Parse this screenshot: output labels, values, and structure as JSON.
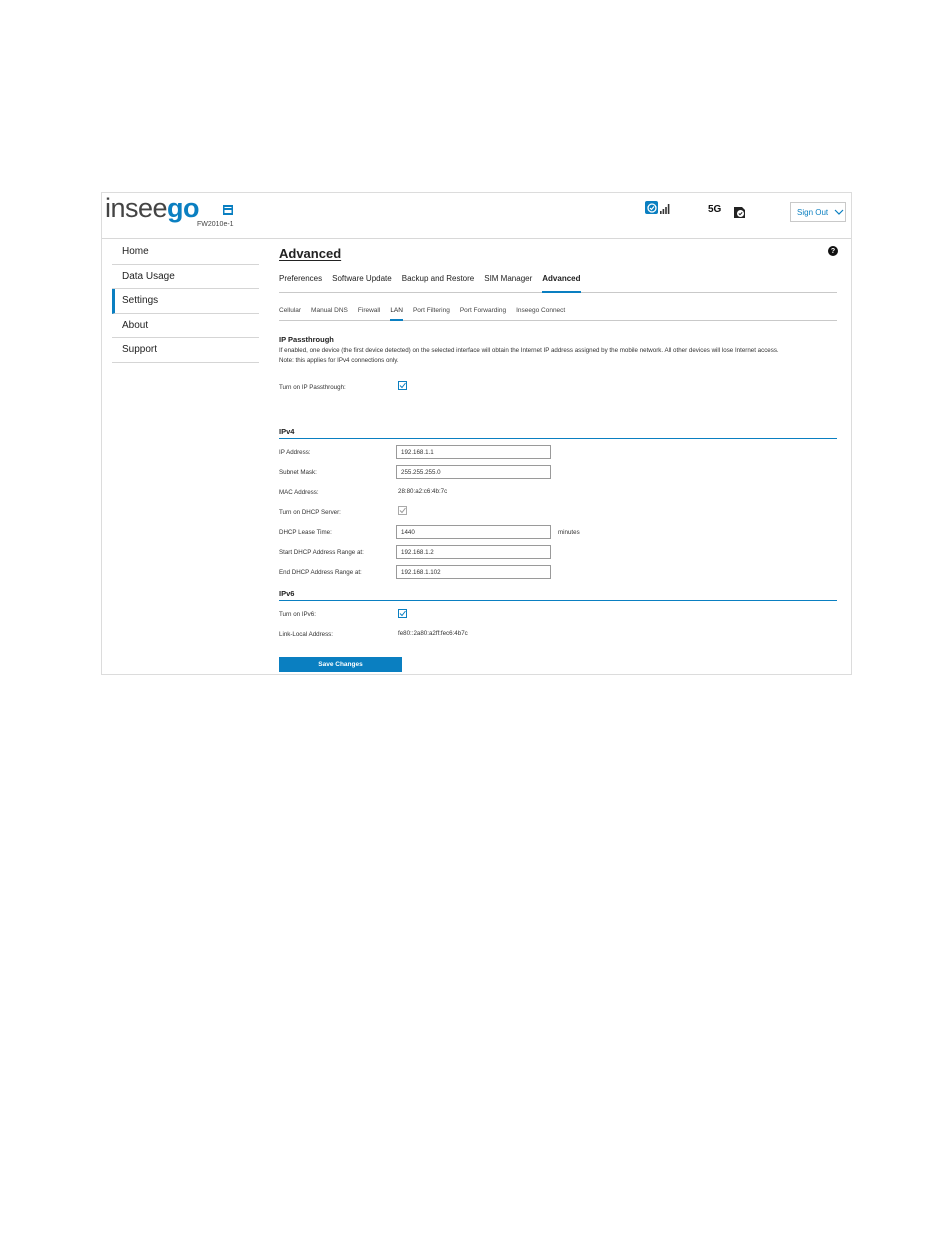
{
  "header": {
    "logo_prefix": "insee",
    "logo_suffix": "go",
    "model": "FW2010e-1",
    "network_label": "5G",
    "signout_label": "Sign Out",
    "icons": [
      "device-icon",
      "wifi-status-icon",
      "signal-bars-icon",
      "sim-icon",
      "chevron-down-icon"
    ]
  },
  "sidebar": {
    "items": [
      {
        "label": "Home"
      },
      {
        "label": "Data Usage"
      },
      {
        "label": "Settings",
        "active": true
      },
      {
        "label": "About"
      },
      {
        "label": "Support"
      }
    ]
  },
  "main": {
    "title": "Advanced",
    "help": "?",
    "tabs": [
      {
        "label": "Preferences"
      },
      {
        "label": "Software Update"
      },
      {
        "label": "Backup and Restore"
      },
      {
        "label": "SIM Manager"
      },
      {
        "label": "Advanced",
        "active": true
      }
    ],
    "subtabs": [
      {
        "label": "Cellular"
      },
      {
        "label": "Manual DNS"
      },
      {
        "label": "Firewall"
      },
      {
        "label": "LAN",
        "active": true
      },
      {
        "label": "Port Filtering"
      },
      {
        "label": "Port Forwarding"
      },
      {
        "label": "Inseego Connect"
      }
    ],
    "ip_passthrough": {
      "title": "IP Passthrough",
      "description_1": "If enabled, one device (the first device detected) on the selected interface will obtain the Internet IP address assigned by the mobile network. All other devices will lose Internet access.",
      "description_2": "Note: this applies for IPv4 connections only.",
      "toggle_label": "Turn on IP Passthrough:",
      "checked": true
    },
    "ipv4": {
      "title": "IPv4",
      "ip_label": "IP Address:",
      "ip_value": "192.168.1.1",
      "subnet_label": "Subnet Mask:",
      "subnet_value": "255.255.255.0",
      "mac_label": "MAC Address:",
      "mac_value": "28:80:a2:c6:4b:7c",
      "dhcp_label": "Turn on DHCP Server:",
      "dhcp_checked": true,
      "lease_label": "DHCP Lease Time:",
      "lease_value": "1440",
      "lease_unit": "minutes",
      "start_label": "Start DHCP Address Range at:",
      "start_value": "192.168.1.2",
      "end_label": "End DHCP Address Range at:",
      "end_value": "192.168.1.102"
    },
    "ipv6": {
      "title": "IPv6",
      "toggle_label": "Turn on IPv6:",
      "checked": true,
      "link_local_label": "Link-Local Address:",
      "link_local_value": "fe80::2a80:a2ff:fec6:4b7c"
    },
    "save_label": "Save Changes"
  },
  "colors": {
    "accent": "#0a7fc1",
    "border": "#d5d5d5"
  }
}
